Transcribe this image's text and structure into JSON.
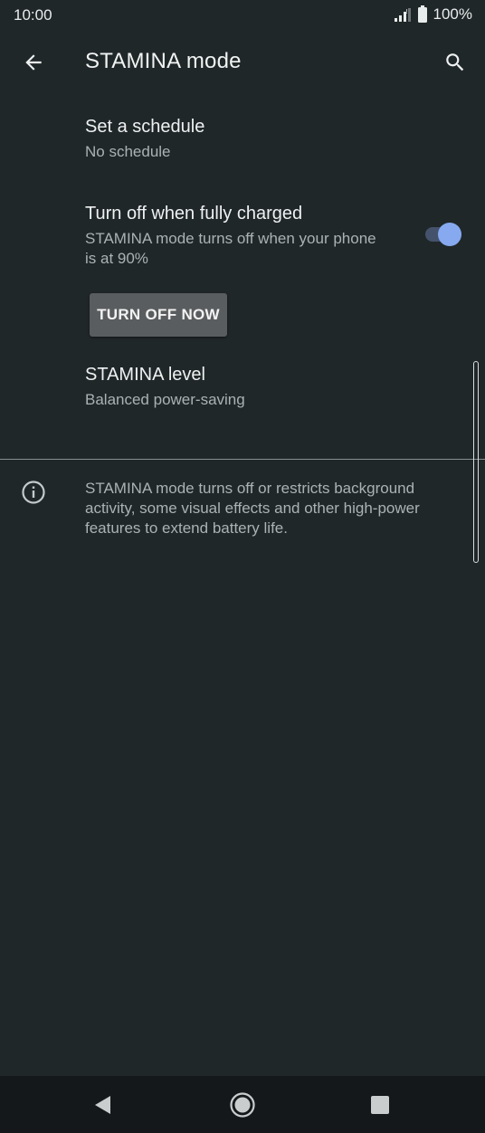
{
  "status_bar": {
    "time": "10:00",
    "battery": "100%",
    "icons": [
      "signal-icon",
      "battery-icon"
    ]
  },
  "app_bar": {
    "title": "STAMINA mode",
    "back_icon": "arrow-back-icon",
    "search_icon": "search-icon"
  },
  "settings": {
    "schedule": {
      "title": "Set a schedule",
      "subtitle": "No schedule"
    },
    "fully_charged": {
      "title": "Turn off when fully charged",
      "subtitle": "STAMINA mode turns off when your phone is at 90%",
      "enabled": true
    },
    "turn_off_button": "TURN OFF NOW",
    "level": {
      "title": "STAMINA level",
      "subtitle": "Balanced power-saving"
    }
  },
  "info": {
    "icon": "info-icon",
    "text": "STAMINA mode turns off or restricts background activity, some visual effects and other high-power features to extend battery life."
  },
  "colors": {
    "background": "#202729",
    "accent": "#86a9ef",
    "toggle_track": "#44526c",
    "button_bg": "#5a5d5f",
    "nav_bar": "#14181a"
  },
  "nav_bar": {
    "icons": [
      "nav-back-icon",
      "nav-home-icon",
      "nav-recents-icon"
    ]
  }
}
